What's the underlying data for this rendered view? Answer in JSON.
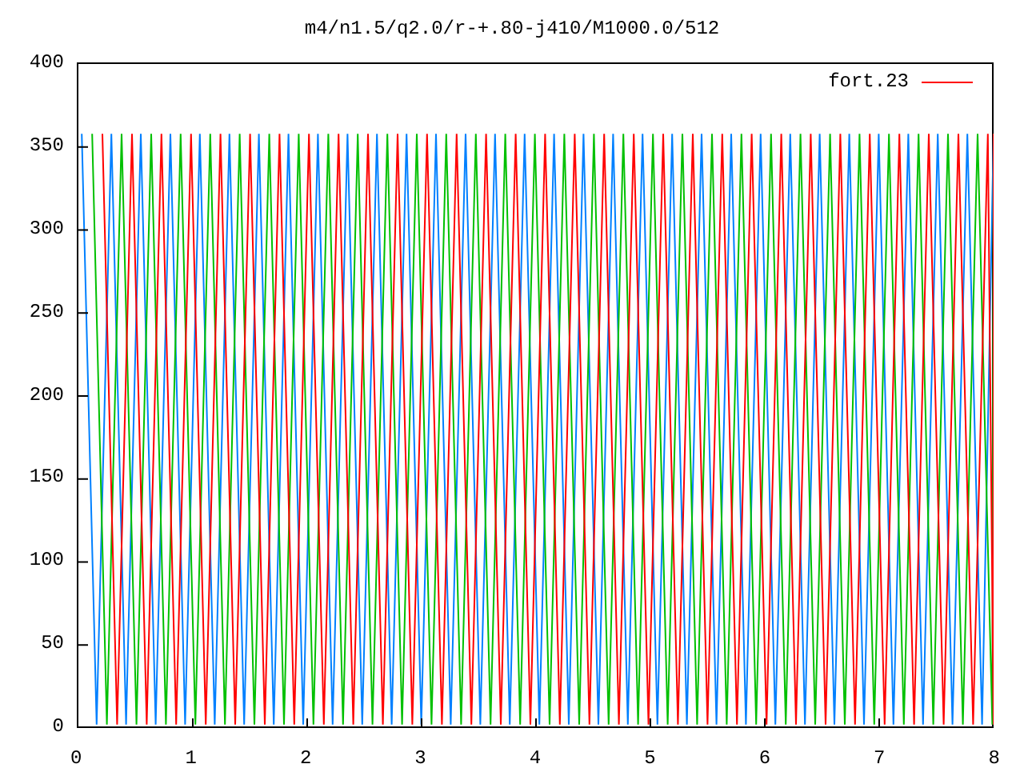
{
  "title": "m4/n1.5/q2.0/r-+.80-j410/M1000.0/512",
  "legend": [
    {
      "label": "fort.23",
      "color": "#ff0000"
    }
  ],
  "y_tick_labels": [
    "400",
    "350",
    "300",
    "250",
    "200",
    "150",
    "100",
    "50",
    "0"
  ],
  "x_tick_labels": [
    "0",
    "1",
    "2",
    "3",
    "4",
    "5",
    "6",
    "7",
    "8"
  ]
}
